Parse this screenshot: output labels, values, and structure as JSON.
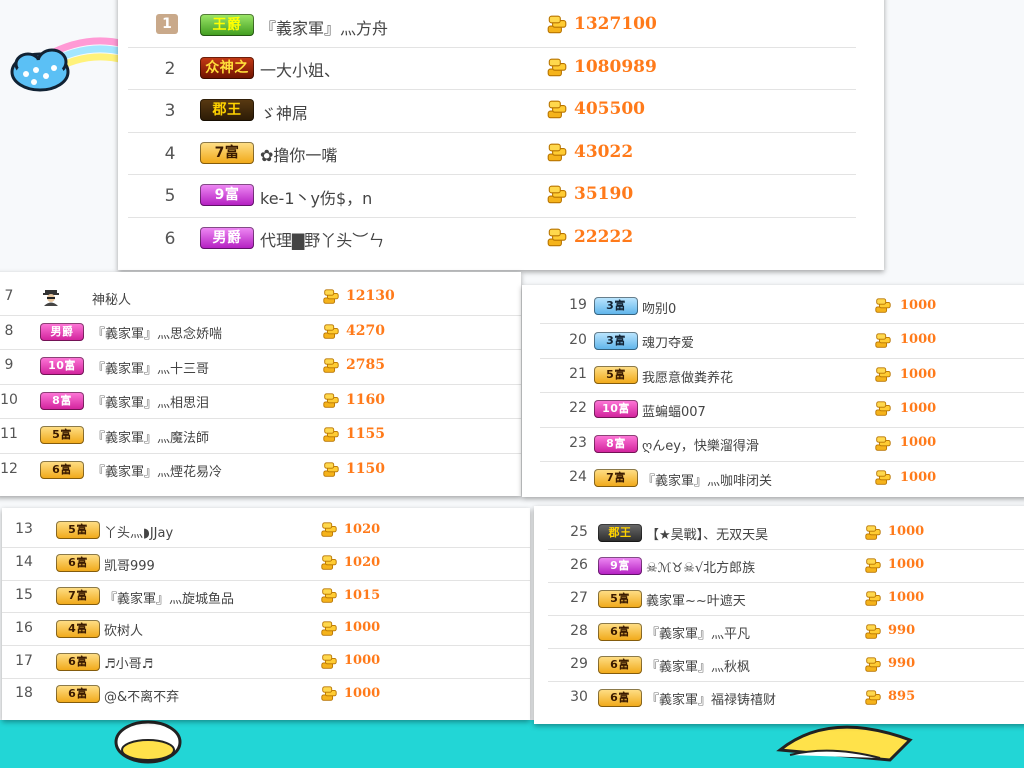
{
  "top": [
    {
      "rank": "1",
      "badge": "王爵",
      "style": "b-green",
      "name": "『義家軍』灬方舟",
      "score": "1327100"
    },
    {
      "rank": "2",
      "badge": "众神之",
      "style": "b-red",
      "name": "一大小姐、",
      "score": "1080989"
    },
    {
      "rank": "3",
      "badge": "郡王",
      "style": "b-dark",
      "name": "ゞ神屌",
      "score": "405500"
    },
    {
      "rank": "4",
      "badge": "7富",
      "style": "b-gold",
      "name": "✿撸你一嘴",
      "score": "43022"
    },
    {
      "rank": "5",
      "badge": "9富",
      "style": "b-purple",
      "name": "ke-1丶y伤$，n",
      "score": "35190"
    },
    {
      "rank": "6",
      "badge": "男爵",
      "style": "b-purple",
      "name": "代理▇野丫头︶ㄣ",
      "score": "22222"
    }
  ],
  "left": [
    {
      "rank": "7",
      "badge": "",
      "style": "",
      "name": "神秘人",
      "score": "12130"
    },
    {
      "rank": "8",
      "badge": "男爵",
      "style": "b-magenta",
      "name": "『義家軍』灬思念娇喘",
      "score": "4270"
    },
    {
      "rank": "9",
      "badge": "10富",
      "style": "b-magenta",
      "name": "『義家軍』灬十三哥",
      "score": "2785"
    },
    {
      "rank": "10",
      "badge": "8富",
      "style": "b-magenta",
      "name": "『義家軍』灬相思泪",
      "score": "1160"
    },
    {
      "rank": "11",
      "badge": "5富",
      "style": "b-gold",
      "name": "『義家軍』灬魔法師",
      "score": "1155"
    },
    {
      "rank": "12",
      "badge": "6富",
      "style": "b-gold",
      "name": "『義家軍』灬煙花易冷",
      "score": "1150"
    }
  ],
  "right": [
    {
      "rank": "19",
      "badge": "3富",
      "style": "b-blue",
      "name": "吻别0",
      "score": "1000"
    },
    {
      "rank": "20",
      "badge": "3富",
      "style": "b-blue",
      "name": "魂刀夺爱",
      "score": "1000"
    },
    {
      "rank": "21",
      "badge": "5富",
      "style": "b-gold",
      "name": "我愿意做粪养花",
      "score": "1000"
    },
    {
      "rank": "22",
      "badge": "10富",
      "style": "b-magenta",
      "name": "蓝蝙蝠007",
      "score": "1000"
    },
    {
      "rank": "23",
      "badge": "8富",
      "style": "b-magenta",
      "name": "ღんey，快樂溜得滑",
      "score": "1000"
    },
    {
      "rank": "24",
      "badge": "7富",
      "style": "b-gold",
      "name": "『義家軍』灬咖啡闭关",
      "score": "1000"
    }
  ],
  "bottom_left": [
    {
      "rank": "13",
      "badge": "5富",
      "style": "b-gold",
      "name": "丫头灬◗JJay",
      "score": "1020"
    },
    {
      "rank": "14",
      "badge": "6富",
      "style": "b-gold",
      "name": "凯哥999",
      "score": "1020"
    },
    {
      "rank": "15",
      "badge": "7富",
      "style": "b-gold",
      "name": "『義家軍』灬旋城鱼品",
      "score": "1015"
    },
    {
      "rank": "16",
      "badge": "4富",
      "style": "b-gold",
      "name": "砍树人",
      "score": "1000"
    },
    {
      "rank": "17",
      "badge": "6富",
      "style": "b-gold",
      "name": "♬小哥♬",
      "score": "1000"
    },
    {
      "rank": "18",
      "badge": "6富",
      "style": "b-gold",
      "name": "@&不离不弃",
      "score": "1000"
    }
  ],
  "bottom_right": [
    {
      "rank": "25",
      "badge": "郡王",
      "style": "b-teal",
      "name": "【★昊戰】、无双天昊",
      "score": "1000"
    },
    {
      "rank": "26",
      "badge": "9富",
      "style": "b-purple",
      "name": "☠ℳ♉☠√北方郎族",
      "score": "1000"
    },
    {
      "rank": "27",
      "badge": "5富",
      "style": "b-gold",
      "name": "義家軍~~叶遮天",
      "score": "1000"
    },
    {
      "rank": "28",
      "badge": "6富",
      "style": "b-gold",
      "name": "『義家軍』灬平凡",
      "score": "990"
    },
    {
      "rank": "29",
      "badge": "6富",
      "style": "b-gold",
      "name": "『義家軍』灬秋枫",
      "score": "990"
    },
    {
      "rank": "30",
      "badge": "6富",
      "style": "b-gold",
      "name": "『義家軍』福禄铸禧财",
      "score": "895"
    }
  ]
}
